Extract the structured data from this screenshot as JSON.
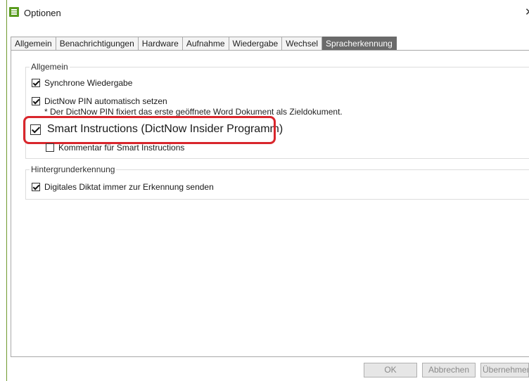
{
  "window": {
    "title": "Optionen",
    "close_symbol": "✕"
  },
  "tabs": [
    {
      "label": "Allgemein",
      "active": false
    },
    {
      "label": "Benachrichtigungen",
      "active": false
    },
    {
      "label": "Hardware",
      "active": false
    },
    {
      "label": "Aufnahme",
      "active": false
    },
    {
      "label": "Wiedergabe",
      "active": false
    },
    {
      "label": "Wechsel",
      "active": false
    },
    {
      "label": "Spracherkennung",
      "active": true
    }
  ],
  "groups": {
    "general": {
      "title": "Allgemein",
      "sync_playback": {
        "label": "Synchrone Wiedergabe",
        "checked": true
      },
      "pin_auto": {
        "label": "DictNow PIN automatisch setzen",
        "checked": true
      },
      "pin_note": "* Der DictNow PIN fixiert das erste geöffnete Word Dokument als Zieldokument.",
      "smart_instructions": {
        "label": "Smart Instructions (DictNow Insider Programm)",
        "checked": true
      },
      "smart_comment": {
        "label": "Kommentar für Smart Instructions",
        "checked": false
      }
    },
    "background": {
      "title": "Hintergrunderkennung",
      "send_always": {
        "label": "Digitales Diktat immer zur Erkennung senden",
        "checked": true
      }
    }
  },
  "buttons": {
    "ok": "OK",
    "cancel": "Abbrechen",
    "apply": "Übernehmen"
  },
  "colors": {
    "accent": "#5a9c1f",
    "highlight": "#d9262c",
    "active_tab": "#6a6a6a"
  }
}
